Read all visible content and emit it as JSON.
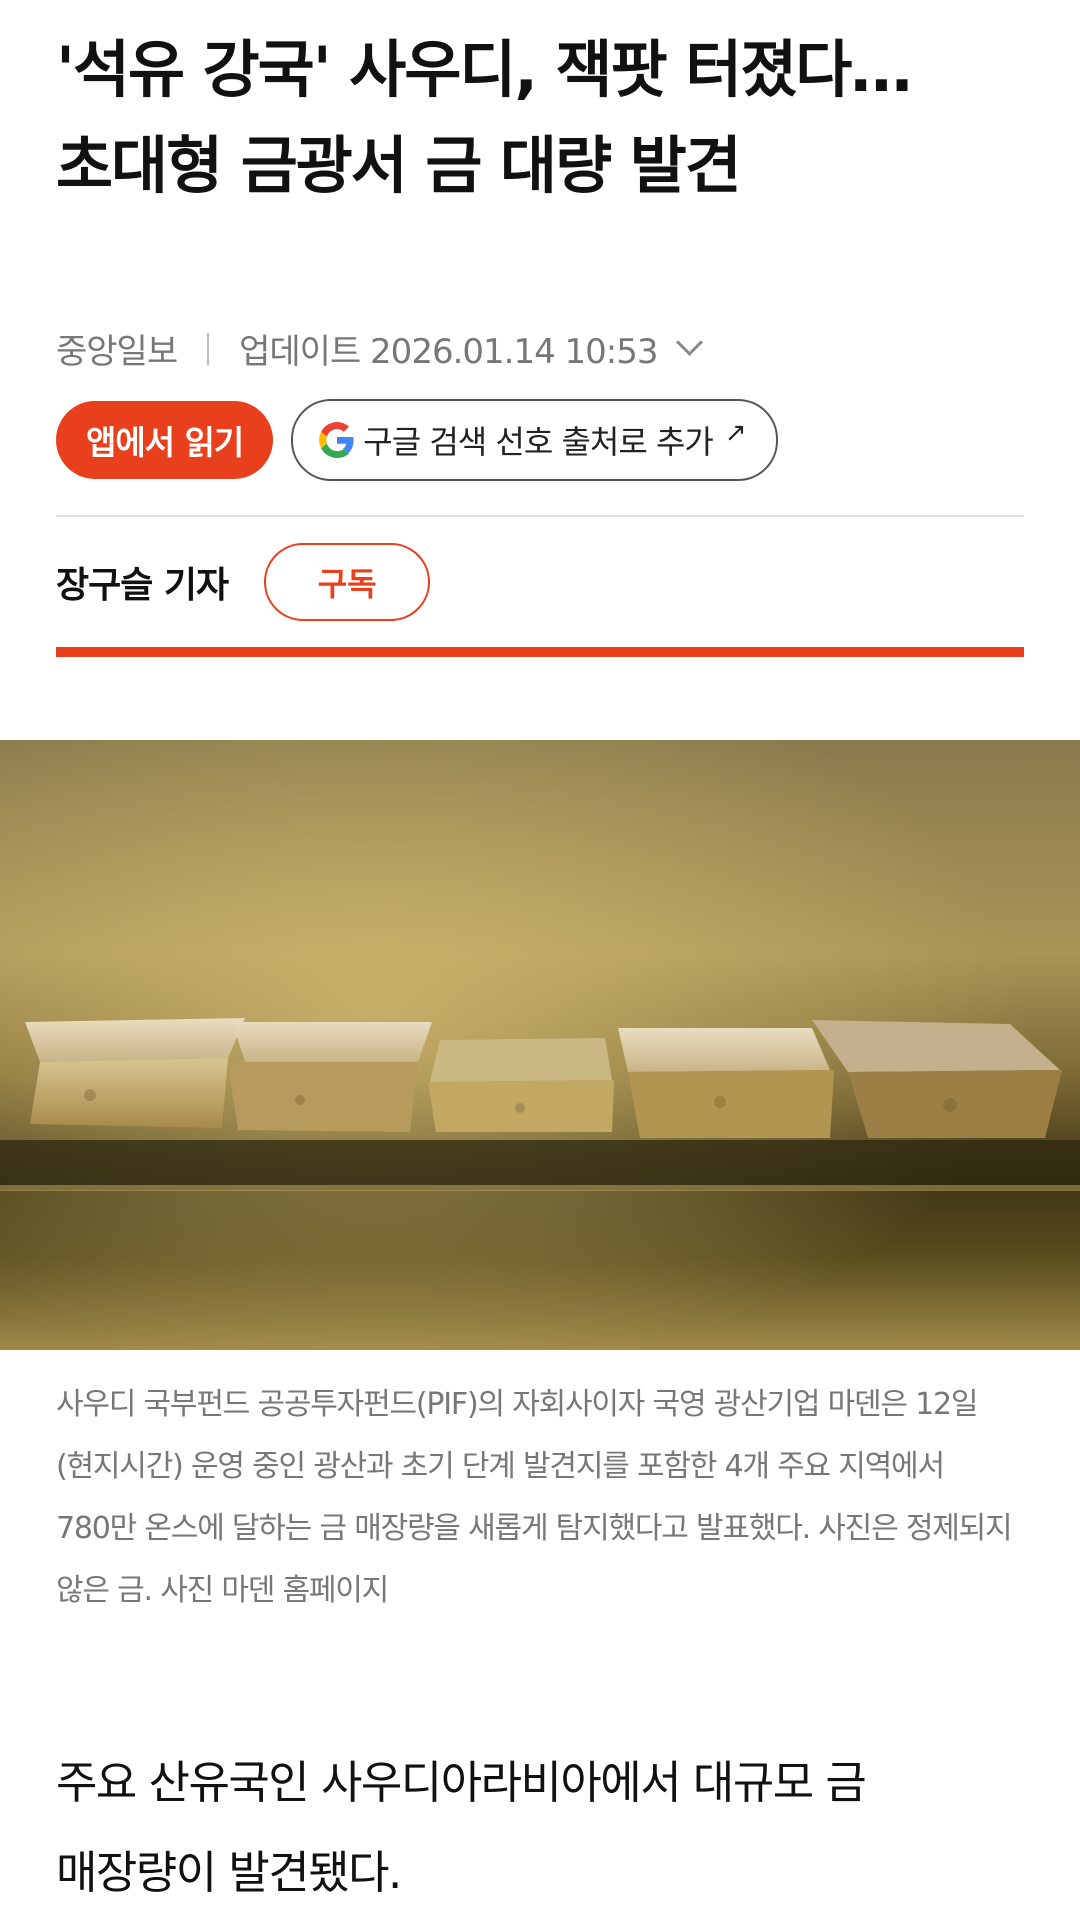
{
  "article": {
    "headline_line1": "'석유 강국' 사우디, 잭팟 터졌다…",
    "headline_line2": "초대형 금광서 금 대량 발견",
    "publisher": "중앙일보",
    "updated_label": "업데이트 2026.01.14 10:53",
    "read_in_app_label": "앱에서 읽기",
    "google_pref_label": "구글 검색 선호 출처로 추가",
    "reporter": "장구슬 기자",
    "subscribe_label": "구독",
    "photo_caption": "사우디 국부펀드 공공투자펀드(PIF)의 자회사이자 국영 광산기업 마덴은 12일(현지시간) 운영 중인 광산과 초기 단계 발견지를 포함한 4개 주요 지역에서 780만 온스에 달하는 금 매장량을 새롭게 탐지했다고 발표했다. 사진은 정제되지 않은 금. 사진 마덴 홈페이지",
    "body_paragraph": "주요 산유국인 사우디아라비아에서 대규모 금 매장량이 발견됐다."
  },
  "icons": {
    "meta_toggle": "chevron-down-icon",
    "google": "google-logo-icon",
    "external": "external-link-icon"
  },
  "colors": {
    "accent": "#e8401c",
    "meta_text": "#777777",
    "headline_text": "#111111"
  }
}
